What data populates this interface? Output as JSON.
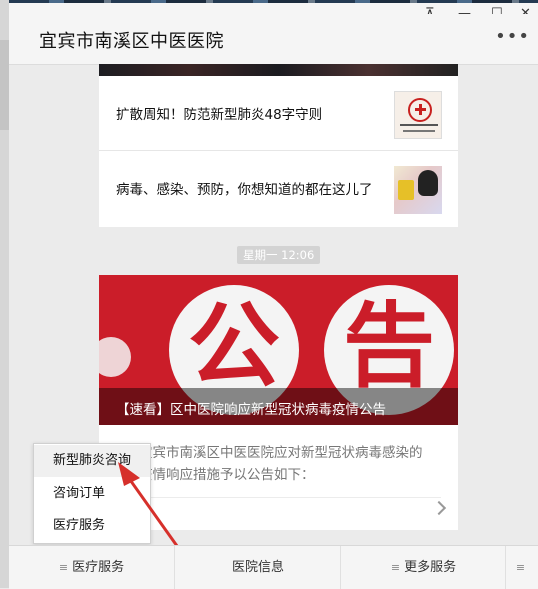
{
  "window": {
    "pin_icon": "⊼",
    "minimize_icon": "—",
    "maximize_icon": "☐",
    "close_icon": "✕"
  },
  "header": {
    "title": "宜宾市南溪区中医医院",
    "more_icon": "•••"
  },
  "articles": [
    {
      "title": "扩散周知！防范新型肺炎48字守则",
      "thumb": "hospital-logo"
    },
    {
      "title": "病毒、感染、预防，你想知道的都在这儿了",
      "thumb": "poster"
    }
  ],
  "timestamp": "星期一 12:06",
  "notice": {
    "glyph_left": "公",
    "glyph_right": "告",
    "caption": "【速看】区中医院响应新型冠状病毒疫情公告",
    "desc_line1": "宜宾市南溪区中医医院应对新型冠状病毒感染的",
    "desc_line2": "疫情响应措施予以公告如下："
  },
  "menu": {
    "items": [
      "新型肺炎咨询",
      "咨询订单",
      "医疗服务"
    ]
  },
  "bottom_tabs": [
    {
      "label": "医疗服务",
      "icon": "≡"
    },
    {
      "label": "医院信息"
    },
    {
      "label": "更多服务",
      "icon": "≡"
    },
    {
      "label": "",
      "icon": "≡"
    }
  ],
  "colors": {
    "accent": "#cb1d29",
    "arrow": "#d6302b"
  }
}
